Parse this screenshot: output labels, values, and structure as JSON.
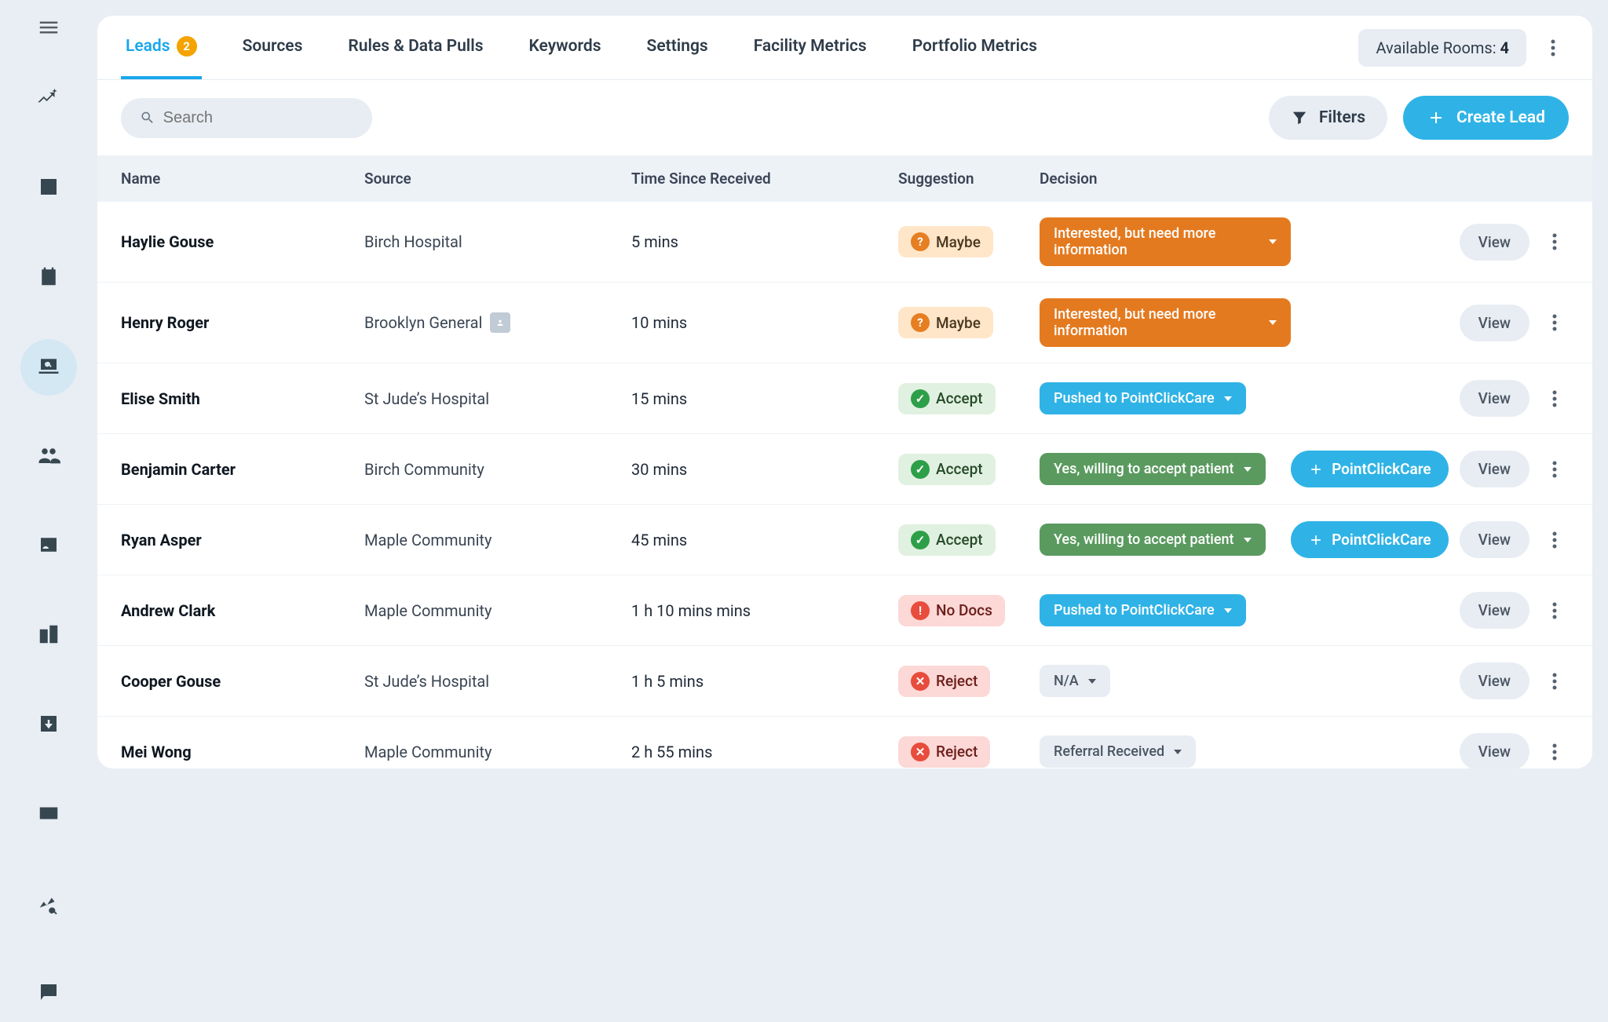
{
  "sidebar": {
    "icons": [
      "sparkle-trend",
      "bar-chart",
      "calendar",
      "laptop-search",
      "people",
      "id-badge",
      "buildings",
      "download-box",
      "card",
      "analytics-search",
      "comment"
    ]
  },
  "tabs": [
    {
      "label": "Leads",
      "active": true,
      "badge": 2
    },
    {
      "label": "Sources"
    },
    {
      "label": "Rules & Data Pulls"
    },
    {
      "label": "Keywords"
    },
    {
      "label": "Settings"
    },
    {
      "label": "Facility Metrics"
    },
    {
      "label": "Portfolio Metrics"
    }
  ],
  "available_rooms_label": "Available Rooms: ",
  "available_rooms_value": "4",
  "search": {
    "placeholder": "Search"
  },
  "filters_label": "Filters",
  "create_lead_label": "Create Lead",
  "view_label": "View",
  "pointclickcare_label": "PointClickCare",
  "columns": [
    "Name",
    "Source",
    "Time Since Received",
    "Suggestion",
    "Decision"
  ],
  "rows": [
    {
      "name": "Haylie Gouse",
      "source": "Birch Hospital",
      "source_icon": false,
      "time": "5 mins",
      "suggestion": "Maybe",
      "decision": "Interested, but need more information",
      "decision_color": "orange",
      "pcc": false
    },
    {
      "name": "Henry Roger",
      "source": "Brooklyn General",
      "source_icon": true,
      "time": "10 mins",
      "suggestion": "Maybe",
      "decision": "Interested, but need more information",
      "decision_color": "orange",
      "pcc": false
    },
    {
      "name": "Elise Smith",
      "source": "St Jude’s Hospital",
      "source_icon": false,
      "time": "15 mins",
      "suggestion": "Accept",
      "decision": "Pushed to PointClickCare",
      "decision_color": "blue",
      "pcc": false
    },
    {
      "name": "Benjamin Carter",
      "source": "Birch Community",
      "source_icon": false,
      "time": "30 mins",
      "suggestion": "Accept",
      "decision": "Yes, willing to accept patient",
      "decision_color": "green",
      "pcc": true
    },
    {
      "name": "Ryan Asper",
      "source": "Maple Community",
      "source_icon": false,
      "time": "45 mins",
      "suggestion": "Accept",
      "decision": "Yes, willing to accept patient",
      "decision_color": "green",
      "pcc": true
    },
    {
      "name": "Andrew Clark",
      "source": "Maple Community",
      "source_icon": false,
      "time": "1 h 10 mins mins",
      "suggestion": "No Docs",
      "decision": "Pushed to PointClickCare",
      "decision_color": "blue",
      "pcc": false
    },
    {
      "name": "Cooper Gouse",
      "source": "St Jude’s Hospital",
      "source_icon": false,
      "time": "1 h 5 mins",
      "suggestion": "Reject",
      "decision": "N/A",
      "decision_color": "gray",
      "pcc": false
    },
    {
      "name": "Mei Wong",
      "source": "Maple Community",
      "source_icon": false,
      "time": "2 h 55 mins",
      "suggestion": "Reject",
      "decision": "Referral Received",
      "decision_color": "gray",
      "pcc": false
    }
  ]
}
